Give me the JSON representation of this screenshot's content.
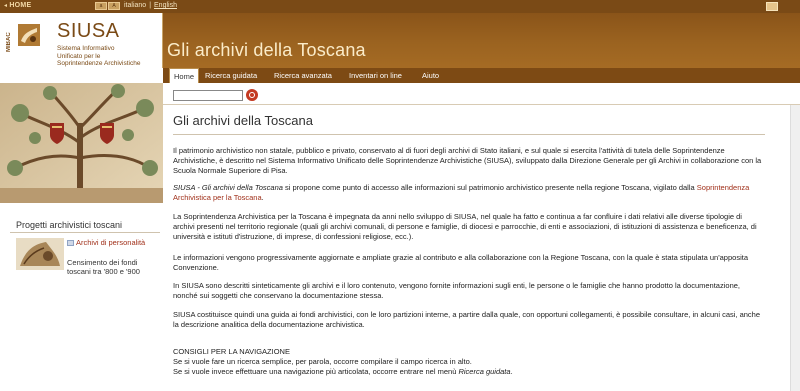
{
  "topbar": {
    "home_label": "HOME",
    "font_small": "a",
    "font_large": "A",
    "lang_it": "italiano",
    "lang_sep": "|",
    "lang_en": "English"
  },
  "logo": {
    "mibac": "MIBAC",
    "name": "SIUSA",
    "subtitle_lines": [
      "Sistema Informativo",
      "Unificato per le",
      "Soprintendenze Archivistiche"
    ]
  },
  "header": {
    "title": "Gli archivi della Toscana"
  },
  "nav": {
    "tabs": [
      {
        "label": "Home",
        "active": true
      },
      {
        "label": "Ricerca guidata",
        "active": false
      },
      {
        "label": "Ricerca avanzata",
        "active": false
      },
      {
        "label": "Inventari on line",
        "active": false
      },
      {
        "label": "Aiuto",
        "active": false
      }
    ]
  },
  "search": {
    "value": ""
  },
  "sidebar": {
    "projects_title": "Progetti archivistici toscani",
    "project_link": "Archivi di personalità",
    "project_desc": "Censimento dei fondi toscani tra '800 e '900"
  },
  "main": {
    "title": "Gli archivi della Toscana",
    "p1": "Il patrimonio archivistico non statale, pubblico e privato, conservato al di fuori degli archivi di Stato italiani, e sul quale si esercita l'attività di tutela delle Soprintendenze Archivistiche, è descritto nel Sistema Informativo Unificato delle Soprintendenze Archivistiche (SIUSA), sviluppato dalla Direzione Generale per gli Archivi in collaborazione con la Scuola Normale Superiore di Pisa.",
    "p2_italic": "SIUSA - Gli archivi della Toscana",
    "p2_text": " si propone come punto di accesso alle informazioni sul patrimonio archivistico presente nella regione Toscana, vigilato dalla ",
    "p2_link": "Soprintendenza Archivistica per la Toscana",
    "p2_end": ".",
    "p3": "La Soprintendenza Archivistica per la Toscana è impegnata da anni nello sviluppo di SIUSA, nel quale ha fatto e continua a far confluire i dati relativi alle diverse tipologie di archivi presenti nel territorio regionale (quali gli archivi comunali, di persone e famiglie, di diocesi e parrocchie, di enti e associazioni, di istituzioni di assistenza e beneficenza, di università e istituti d'istruzione, di imprese, di confessioni religiose, ecc.).",
    "p4": "Le informazioni vengono progressivamente aggiornate e ampliate grazie al contributo e alla collaborazione con la Regione Toscana, con la quale è stata stipulata un'apposita Convenzione.",
    "p5": "In SIUSA sono descritti sinteticamente gli archivi e il loro contenuto, vengono fornite informazioni sugli enti, le persone o le famiglie che hanno prodotto la documentazione, nonché sui soggetti che conservano la documentazione stessa.",
    "p6": "SIUSA costituisce quindi una guida ai fondi archivistici, con le loro partizioni interne, a partire dalla quale, con opportuni collegamenti, è possibile consultare, in alcuni casi, anche la descrizione analitica della documentazione archivistica.",
    "tips_heading": "CONSIGLI PER LA NAVIGAZIONE",
    "tip1": "Se si vuole fare un ricerca semplice, per parola, occorre compilare il campo ricerca in alto.",
    "tip2_text": "Se si vuole invece effettuare una navigazione più articolata, occorre entrare nel menù ",
    "tip2_italic": "Ricerca guidata",
    "tip2_end": "."
  },
  "colors": {
    "brown": "#7a4a16",
    "band": "#9b6320",
    "link": "#a0301a"
  }
}
